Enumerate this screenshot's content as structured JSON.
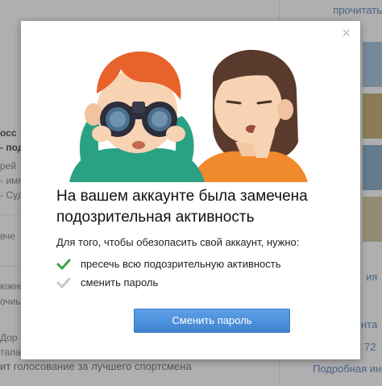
{
  "background": {
    "top_link": "прочитать",
    "left_texts": [
      {
        "text": "осс",
        "bold": true
      },
      {
        "text": "- под",
        "bold": true
      },
      {
        "text": "рей",
        "bold": false
      },
      {
        "text": "- имя",
        "bold": false
      },
      {
        "text": "- Суд",
        "bold": false
      },
      {
        "text": "вче",
        "bold": false
      },
      {
        "text": "южно",
        "bold": false
      },
      {
        "text": "очиь",
        "bold": false
      },
      {
        "text": "Дор",
        "bold": false
      },
      {
        "text": "тала",
        "bold": false
      }
    ],
    "right_links": [
      "ия",
      "нта",
      "72",
      "Подробная инфо"
    ],
    "bottom_text": "ит голосование за лучшего спортсмена"
  },
  "modal": {
    "close_label": "×",
    "title": "На вашем аккаунте была замечена подозрительная активность",
    "subtitle": "Для того, чтобы обезопасить свой аккаунт, нужно:",
    "steps": [
      {
        "label": "пресечь всю подозрительную активность",
        "done": true
      },
      {
        "label": "сменить пароль",
        "done": false
      }
    ],
    "button_label": "Сменить пароль"
  },
  "colors": {
    "accent": "#4a8fdc",
    "check_done": "#3aa24a",
    "check_pending": "#c8c8c8",
    "hair_boy": "#e8632b",
    "hair_girl": "#5a3a2c",
    "shirt_boy": "#2aa182",
    "shirt_girl": "#f08a2c"
  }
}
